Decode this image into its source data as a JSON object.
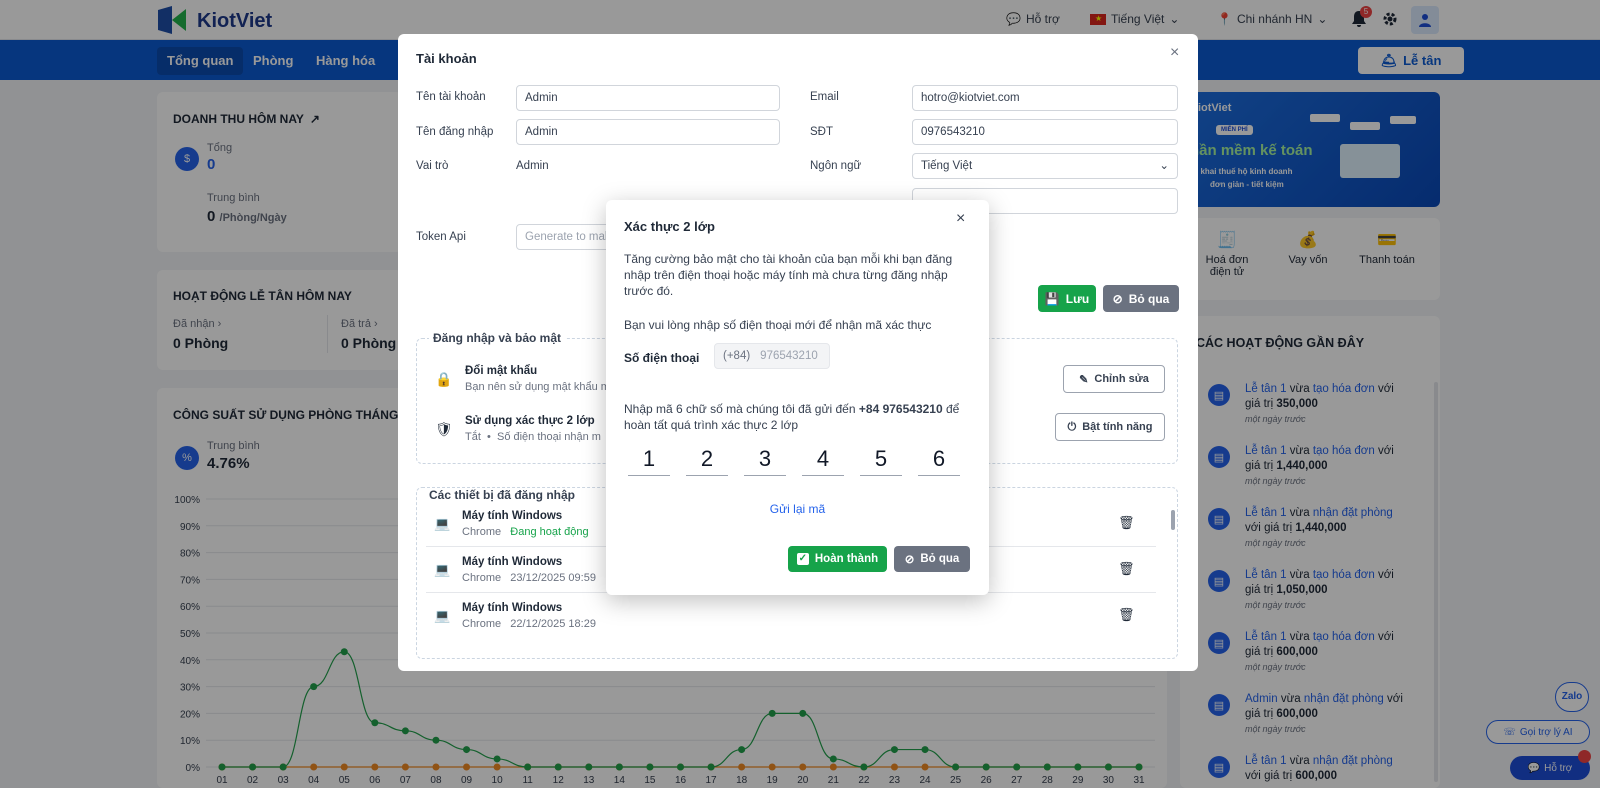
{
  "header": {
    "brand": "KiotViet",
    "support": "Hỗ trợ",
    "language": "Tiếng Việt",
    "branch": "Chi nhánh HN",
    "notif_count": "5"
  },
  "nav": {
    "tabs": [
      "Tổng quan",
      "Phòng",
      "Hàng hóa"
    ],
    "reception_button": "Lễ tân"
  },
  "revenue": {
    "title": "DOANH THU HÔM NAY",
    "total_label": "Tổng",
    "total_value": "0",
    "avg_label": "Trung bình",
    "avg_value": "0",
    "avg_unit": "/Phòng/Ngày"
  },
  "reception_activity": {
    "title": "HOẠT ĐỘNG LỄ TÂN HÔM NAY",
    "received_label": "Đã nhận",
    "received_value": "0 Phòng",
    "returned_label": "Đã trả",
    "returned_value": "0 Phòng"
  },
  "occupancy": {
    "title": "CÔNG SUẤT SỬ DỤNG PHÒNG THÁNG I",
    "avg_label": "Trung bình",
    "avg_value": "4.76%"
  },
  "chart_data": {
    "type": "line",
    "x": [
      "01",
      "02",
      "03",
      "04",
      "05",
      "06",
      "07",
      "08",
      "09",
      "10",
      "11",
      "12",
      "13",
      "14",
      "15",
      "16",
      "17",
      "18",
      "19",
      "20",
      "21",
      "22",
      "23",
      "24",
      "25",
      "26",
      "27",
      "28",
      "29",
      "30",
      "31"
    ],
    "y_ticks": [
      "0%",
      "10%",
      "20%",
      "30%",
      "40%",
      "50%",
      "60%",
      "70%",
      "80%",
      "90%",
      "100%"
    ],
    "ylim": [
      0,
      100
    ],
    "grid": true,
    "series": [
      {
        "color": "#22a04b",
        "values": [
          0,
          0,
          0,
          30,
          43,
          16.5,
          13.5,
          10,
          6.5,
          3,
          0,
          0,
          0,
          0,
          0,
          0,
          0,
          6.5,
          20,
          20,
          3,
          0,
          6.5,
          6.5,
          0,
          0,
          0,
          0,
          0,
          0,
          0
        ]
      },
      {
        "color": "#f08a24",
        "values": [
          0,
          0,
          0,
          0,
          0,
          0,
          0,
          0,
          0,
          0,
          0,
          0,
          0,
          0,
          0,
          0,
          0,
          0,
          0,
          0,
          0,
          0,
          0,
          0,
          0,
          0,
          0,
          0,
          0,
          0,
          0
        ]
      }
    ]
  },
  "promo": {
    "brand": "KiotViet",
    "badge": "MIỄN PHÍ",
    "headline": "Phần mềm kế toán",
    "line1": "Kê khai thuế hộ kinh doanh",
    "line2": "đơn giản - tiết kiệm"
  },
  "services": [
    {
      "label": "Hoá đơn điện tử"
    },
    {
      "label": "Vay vốn"
    },
    {
      "label": "Thanh toán"
    }
  ],
  "recent": {
    "title": "CÁC HOẠT ĐỘNG GẦN ĐÂY",
    "items": [
      {
        "actor": "Lễ tân 1",
        "mid": "vừa",
        "action": "tạo hóa đơn",
        "tail": "với giá",
        "pre": "trị",
        "value": "350,000",
        "time": "một ngày trước"
      },
      {
        "actor": "Lễ tân 1",
        "mid": "vừa",
        "action": "tạo hóa đơn",
        "tail": "với giá",
        "pre": "trị",
        "value": "1,440,000",
        "time": "một ngày trước"
      },
      {
        "actor": "Lễ tân 1",
        "mid": "vừa",
        "action": "nhận đặt phòng",
        "tail": "với",
        "pre": "giá trị",
        "value": "1,440,000",
        "time": "một ngày trước"
      },
      {
        "actor": "Lễ tân 1",
        "mid": "vừa",
        "action": "tạo hóa đơn",
        "tail": "với giá",
        "pre": "trị",
        "value": "1,050,000",
        "time": "một ngày trước"
      },
      {
        "actor": "Lễ tân 1",
        "mid": "vừa",
        "action": "tạo hóa đơn",
        "tail": "với giá",
        "pre": "trị",
        "value": "600,000",
        "time": "một ngày trước"
      },
      {
        "actor": "Admin",
        "mid": "vừa",
        "action": "nhận đặt phòng",
        "tail": "với",
        "pre": "giá trị",
        "value": "600,000",
        "time": "một ngày trước"
      },
      {
        "actor": "Lễ tân 1",
        "mid": "vừa",
        "action": "nhận đặt phòng",
        "tail": "với",
        "pre": "giá trị",
        "value": "600,000",
        "time": ""
      }
    ]
  },
  "floating": {
    "zalo": "Zalo",
    "ai": "Gọi trợ lý AI",
    "support": "Hỗ trợ"
  },
  "account": {
    "title": "Tài khoản",
    "account_name_label": "Tên tài khoản",
    "account_name_value": "Admin",
    "username_label": "Tên đăng nhập",
    "username_value": "Admin",
    "role_label": "Vai trò",
    "role_value": "Admin",
    "token_label": "Token Api",
    "token_placeholder": "Generate to make",
    "email_label": "Email",
    "email_value": "hotro@kiotviet.com",
    "phone_label": "SĐT",
    "phone_value": "0976543210",
    "lang_label": "Ngôn ngữ",
    "lang_value": "Tiếng Việt",
    "save": "Lưu",
    "skip": "Bỏ qua",
    "security_title": "Đăng nhập và bảo mật",
    "pw_title": "Đổi mật khẩu",
    "pw_desc": "Bạn nên sử dụng mật khẩu m",
    "pw_edit": "Chỉnh sửa",
    "tfa_title": "Sử dụng xác thực 2 lớp",
    "tfa_status": "Tắt",
    "tfa_desc": "Số điện thoại nhận m",
    "tfa_enable": "Bật tính năng",
    "devices_title": "Các thiết bị đã đăng nhập",
    "devices": [
      {
        "name": "Máy tính Windows",
        "browser": "Chrome",
        "status": "Đang hoạt động"
      },
      {
        "name": "Máy tính Windows",
        "browser": "Chrome",
        "status": "23/12/2025 09:59"
      },
      {
        "name": "Máy tính Windows",
        "browser": "Chrome",
        "status": "22/12/2025 18:29"
      }
    ]
  },
  "tfa": {
    "title": "Xác thực 2 lớp",
    "intro": "Tăng cường bảo mật cho tài khoản của bạn mỗi khi bạn đăng nhập trên điện thoại hoặc máy tính mà chưa từng đăng nhập trước đó.",
    "prompt": "Bạn vui lòng nhập số điện thoại mới để nhận mã xác thực",
    "phone_label": "Số điện thoại",
    "phone_prefix": "(+84)",
    "phone_value": "976543210",
    "code_msg_pre": "Nhập mã 6 chữ số mà chúng tôi đã gửi đến",
    "code_msg_phone": "+84 976543210",
    "code_msg_post": "để hoàn tất quá trình xác thực 2 lớp",
    "digits": [
      "1",
      "2",
      "3",
      "4",
      "5",
      "6"
    ],
    "resend": "Gửi lại mã",
    "done": "Hoàn thành",
    "cancel": "Bỏ qua"
  }
}
